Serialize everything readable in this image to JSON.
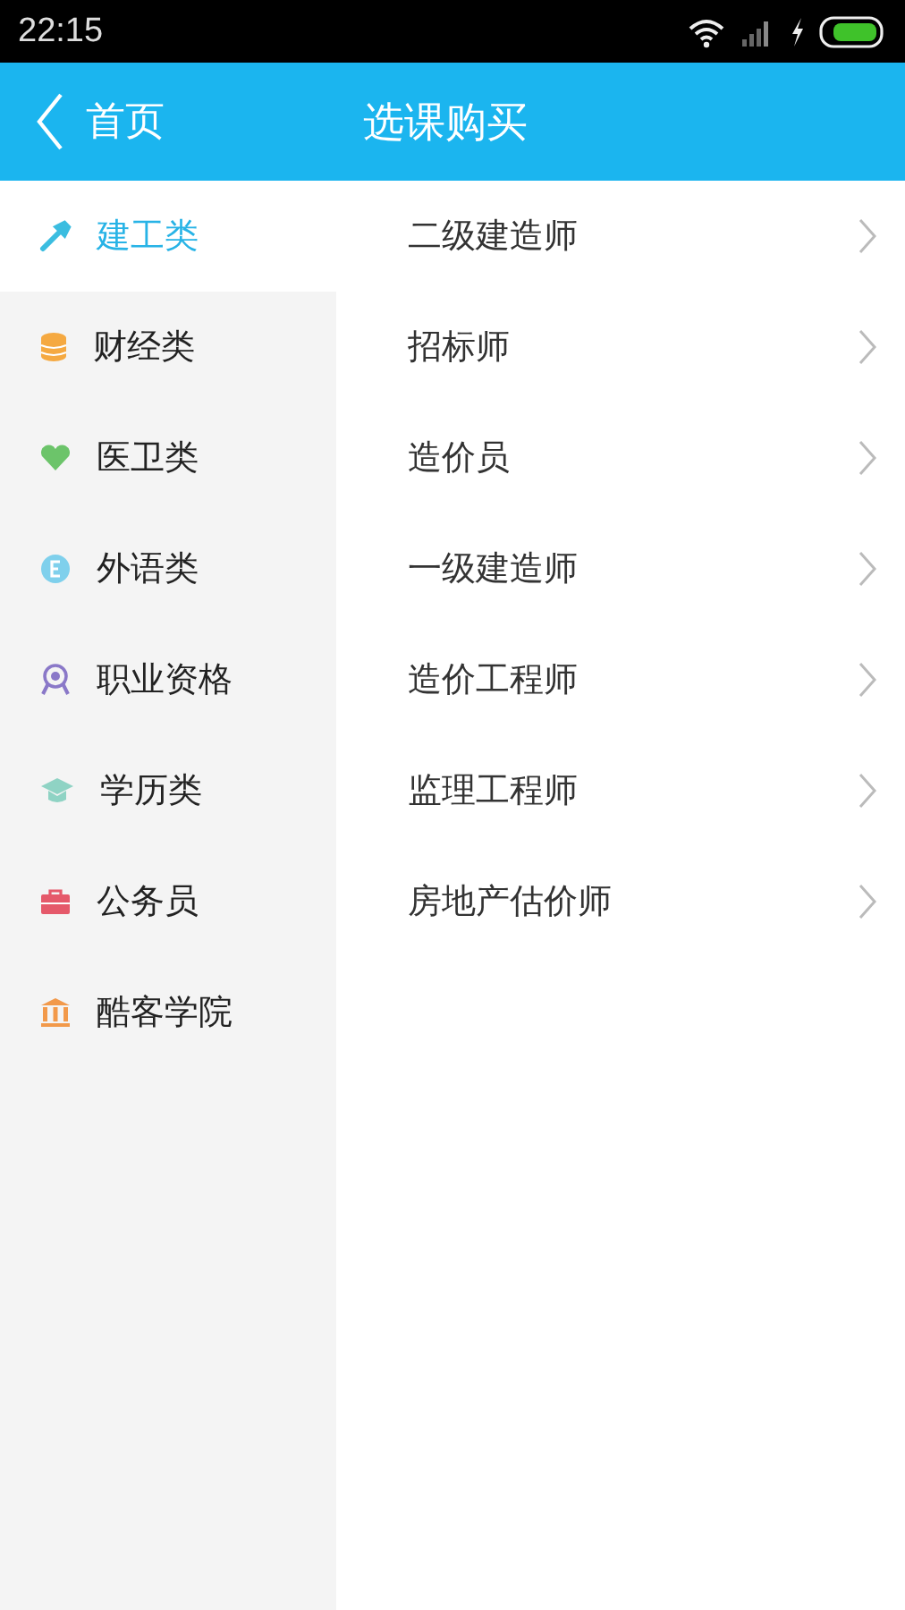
{
  "status_bar": {
    "time": "22:15"
  },
  "header": {
    "back_label": "首页",
    "title": "选课购买"
  },
  "sidebar": {
    "items": [
      {
        "label": "建工类",
        "selected": true,
        "color": "#3bbde0"
      },
      {
        "label": "财经类",
        "selected": false,
        "color": "#f5a941"
      },
      {
        "label": "医卫类",
        "selected": false,
        "color": "#6cc46a"
      },
      {
        "label": "外语类",
        "selected": false,
        "color": "#7fd0ec"
      },
      {
        "label": "职业资格",
        "selected": false,
        "color": "#8a78c8"
      },
      {
        "label": "学历类",
        "selected": false,
        "color": "#8fd3c4"
      },
      {
        "label": "公务员",
        "selected": false,
        "color": "#e5596a"
      },
      {
        "label": "酷客学院",
        "selected": false,
        "color": "#f2994a"
      }
    ]
  },
  "courses": [
    "二级建造师",
    "招标师",
    "造价员",
    "一级建造师",
    "造价工程师",
    "监理工程师",
    "房地产估价师"
  ]
}
